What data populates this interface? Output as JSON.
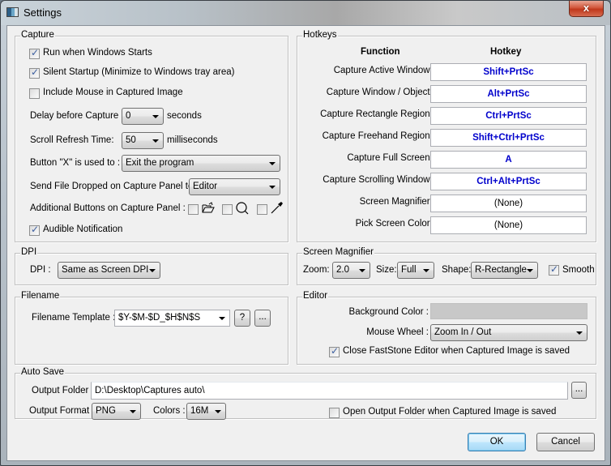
{
  "window": {
    "title": "Settings",
    "close_label": "x"
  },
  "capture": {
    "title": "Capture",
    "run_when_windows_starts": {
      "label": "Run when Windows Starts",
      "checked": true
    },
    "silent_startup": {
      "label": "Silent Startup (Minimize to Windows tray area)",
      "checked": true
    },
    "include_mouse": {
      "label": "Include Mouse in Captured Image",
      "checked": false
    },
    "delay": {
      "label": "Delay before Capture :",
      "value": "0",
      "unit": "seconds"
    },
    "scroll_refresh": {
      "label": "Scroll Refresh Time:",
      "value": "50",
      "unit": "milliseconds"
    },
    "button_x": {
      "label": "Button \"X\" is used to :",
      "value": "Exit the program"
    },
    "send_file": {
      "label": "Send File Dropped on Capture Panel to :",
      "value": "Editor"
    },
    "additional_buttons": {
      "label": "Additional Buttons on Capture Panel :",
      "items": [
        {
          "icon": "open-folder-icon",
          "checked": false
        },
        {
          "icon": "magnifier-icon",
          "checked": false
        },
        {
          "icon": "eyedropper-icon",
          "checked": false
        }
      ]
    },
    "audible_notification": {
      "label": "Audible Notification",
      "checked": true
    }
  },
  "hotkeys": {
    "title": "Hotkeys",
    "col_function": "Function",
    "col_hotkey": "Hotkey",
    "rows": [
      {
        "function": "Capture Active Window :",
        "hotkey": "Shift+PrtSc"
      },
      {
        "function": "Capture Window / Object :",
        "hotkey": "Alt+PrtSc"
      },
      {
        "function": "Capture Rectangle Region :",
        "hotkey": "Ctrl+PrtSc"
      },
      {
        "function": "Capture Freehand Region :",
        "hotkey": "Shift+Ctrl+PrtSc"
      },
      {
        "function": "Capture Full Screen :",
        "hotkey": "A"
      },
      {
        "function": "Capture Scrolling Window :",
        "hotkey": "Ctrl+Alt+PrtSc"
      },
      {
        "function": "Screen Magnifier :",
        "hotkey": "(None)"
      },
      {
        "function": "Pick Screen Color :",
        "hotkey": "(None)"
      }
    ],
    "hotkey_color": "#0000cc"
  },
  "dpi": {
    "title": "DPI",
    "label": "DPI :",
    "value": "Same as Screen DPI"
  },
  "screen_magnifier": {
    "title": "Screen Magnifier",
    "zoom_label": "Zoom:",
    "zoom_value": "2.0",
    "size_label": "Size:",
    "size_value": "Full",
    "shape_label": "Shape:",
    "shape_value": "R-Rectangle",
    "smooth": {
      "label": "Smooth",
      "checked": true
    }
  },
  "filename": {
    "title": "Filename",
    "label": "Filename Template :",
    "value": "$Y-$M-$D_$H$N$S",
    "help_label": "?",
    "browse_label": "..."
  },
  "editor": {
    "title": "Editor",
    "background_color_label": "Background Color :",
    "background_color": "#c8c8c8",
    "mouse_wheel_label": "Mouse Wheel :",
    "mouse_wheel_value": "Zoom In / Out",
    "close_editor": {
      "label": "Close FastStone Editor when Captured Image is saved",
      "checked": true
    }
  },
  "auto_save": {
    "title": "Auto Save",
    "output_folder_label": "Output Folder :",
    "output_folder_value": "D:\\Desktop\\Captures auto\\",
    "browse_label": "...",
    "output_format_label": "Output Format :",
    "output_format_value": "PNG",
    "colors_label": "Colors :",
    "colors_value": "16M",
    "open_output_folder": {
      "label": "Open Output Folder when Captured Image is saved",
      "checked": false
    }
  },
  "footer": {
    "ok_label": "OK",
    "cancel_label": "Cancel"
  }
}
